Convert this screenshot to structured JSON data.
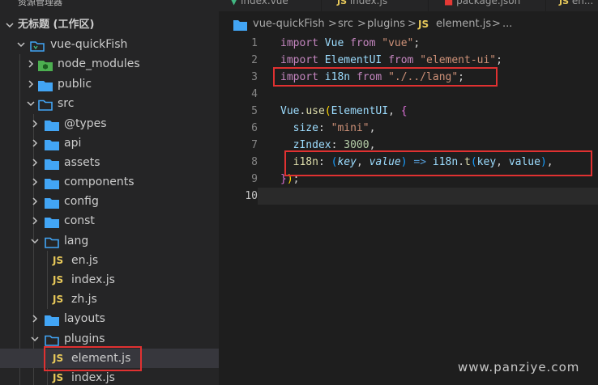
{
  "explorer": {
    "header": "资源管理器",
    "more": "···",
    "workspace": "无标题 (工作区)",
    "tree": [
      {
        "label": "vue-quickFish",
        "type": "root"
      },
      {
        "label": "node_modules",
        "type": "folder"
      },
      {
        "label": "public",
        "type": "folder"
      },
      {
        "label": "src",
        "type": "folder"
      },
      {
        "label": "@types",
        "type": "folder"
      },
      {
        "label": "api",
        "type": "folder"
      },
      {
        "label": "assets",
        "type": "folder"
      },
      {
        "label": "components",
        "type": "folder"
      },
      {
        "label": "config",
        "type": "folder"
      },
      {
        "label": "const",
        "type": "folder"
      },
      {
        "label": "lang",
        "type": "folder"
      },
      {
        "label": "en.js",
        "type": "file"
      },
      {
        "label": "index.js",
        "type": "file"
      },
      {
        "label": "zh.js",
        "type": "file"
      },
      {
        "label": "layouts",
        "type": "folder"
      },
      {
        "label": "plugins",
        "type": "folder"
      },
      {
        "label": "element.js",
        "type": "file"
      },
      {
        "label": "index.js",
        "type": "file"
      }
    ],
    "js_badge": "JS"
  },
  "tabs": [
    {
      "label": "index.vue"
    },
    {
      "label": "index.js"
    },
    {
      "label": "package.json"
    },
    {
      "label": "en..."
    }
  ],
  "breadcrumb": [
    "vue-quickFish",
    ">",
    "src",
    ">",
    "plugins",
    ">",
    "JS",
    "element.js",
    ">",
    "..."
  ],
  "editor": {
    "line_numbers": [
      "1",
      "2",
      "3",
      "4",
      "5",
      "6",
      "7",
      "8",
      "9",
      "10"
    ]
  },
  "watermark": "www.panziye.com",
  "colors": {
    "accent": "#3794ff",
    "highlight_box": "#e03131"
  }
}
